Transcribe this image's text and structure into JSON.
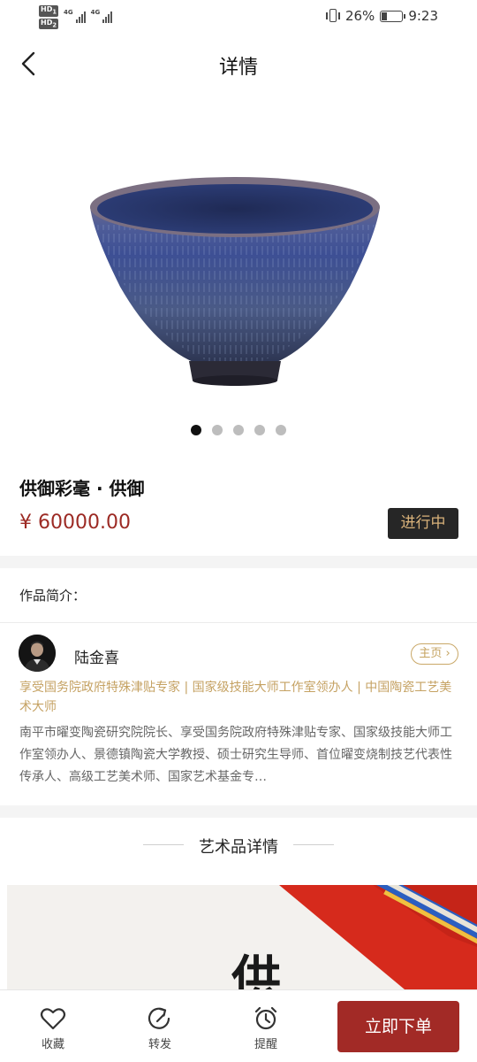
{
  "status_bar": {
    "net_badge": "HD",
    "net_sub_1": "1",
    "net_sub_2": "2",
    "signal_1": "4G",
    "signal_2": "4G",
    "battery": "26%",
    "time": "9:23"
  },
  "nav": {
    "title": "详情"
  },
  "gallery": {
    "slide_count": 5,
    "active_index": 0
  },
  "product": {
    "title": "供御彩毫 · 供御",
    "price": "¥ 60000.00",
    "status": "进行中"
  },
  "intro": {
    "label": "作品简介：",
    "artist_name": "陆金喜",
    "home_label": "主页",
    "titles": "享受国务院政府特殊津贴专家 | 国家级技能大师工作室领办人 | 中国陶瓷工艺美术大师",
    "bio": "南平市曜变陶瓷研究院院长、享受国务院政府特殊津贴专家、国家级技能大师工作室领办人、景德镇陶瓷大学教授、硕士研究生导师、首位曜变烧制技艺代表性传承人、高级工艺美术师、国家艺术基金专…"
  },
  "details": {
    "title": "艺术品详情",
    "banner_char": "供"
  },
  "bottom_bar": {
    "favorite_label": "收藏",
    "share_label": "转发",
    "remind_label": "提醒",
    "order_label": "立即下单"
  },
  "colors": {
    "price": "#9c2a24",
    "accent_gold": "#c5a263",
    "order_button": "#a22a26",
    "status_pill_bg": "#262626"
  }
}
